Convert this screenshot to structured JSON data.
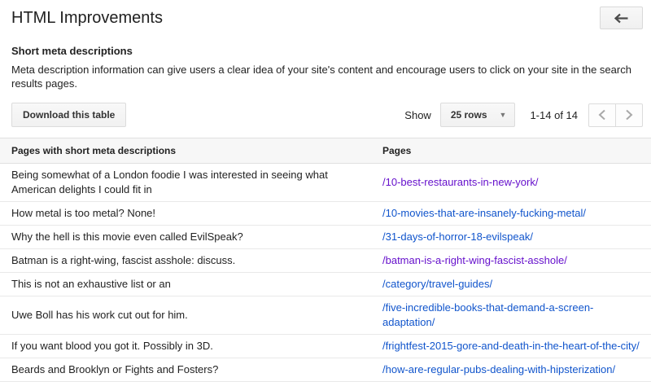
{
  "page": {
    "title": "HTML Improvements"
  },
  "header": {
    "back_button_icon": "arrow-left-icon"
  },
  "section": {
    "heading": "Short meta descriptions",
    "description": "Meta description information can give users a clear idea of your site's content and encourage users to click on your site in the search results pages."
  },
  "table_controls": {
    "download_label": "Download this table",
    "show_label": "Show",
    "rows_per_page_value": "25 rows",
    "rows_dropdown_icon": "caret-down-icon",
    "range_text": "1-14 of 14",
    "prev_icon": "chevron-left-icon",
    "next_icon": "chevron-right-icon"
  },
  "table": {
    "columns": [
      "Pages with short meta descriptions",
      "Pages"
    ],
    "rows": [
      {
        "description": "Being somewhat of a London foodie I was interested in seeing what American delights I could fit in",
        "page": "/10-best-restaurants-in-new-york/",
        "visited": true
      },
      {
        "description": "How metal is too metal? None!",
        "page": "/10-movies-that-are-insanely-fucking-metal/",
        "visited": false
      },
      {
        "description": "Why the hell is this movie even called EvilSpeak?",
        "page": "/31-days-of-horror-18-evilspeak/",
        "visited": false
      },
      {
        "description": "Batman is a right-wing, fascist asshole: discuss.",
        "page": "/batman-is-a-right-wing-fascist-asshole/",
        "visited": true
      },
      {
        "description": "This is not an exhaustive list or an",
        "page": "/category/travel-guides/",
        "visited": false
      },
      {
        "description": "Uwe Boll has his work cut out for him.",
        "page": "/five-incredible-books-that-demand-a-screen-adaptation/",
        "visited": false
      },
      {
        "description": "If you want blood you got it. Possibly in 3D.",
        "page": "/frightfest-2015-gore-and-death-in-the-heart-of-the-city/",
        "visited": false
      },
      {
        "description": "Beards and Brooklyn or Fights and Fosters?",
        "page": "/how-are-regular-pubs-dealing-with-hipsterization/",
        "visited": false
      }
    ]
  },
  "colors": {
    "link": "#1155cc",
    "link_visited": "#6611cc",
    "header_row_bg": "#f7f7f7",
    "button_text": "#333333",
    "divider": "#e9e9e9",
    "pager_icon": "#a9a9a9",
    "back_arrow": "#4c4c4c"
  }
}
